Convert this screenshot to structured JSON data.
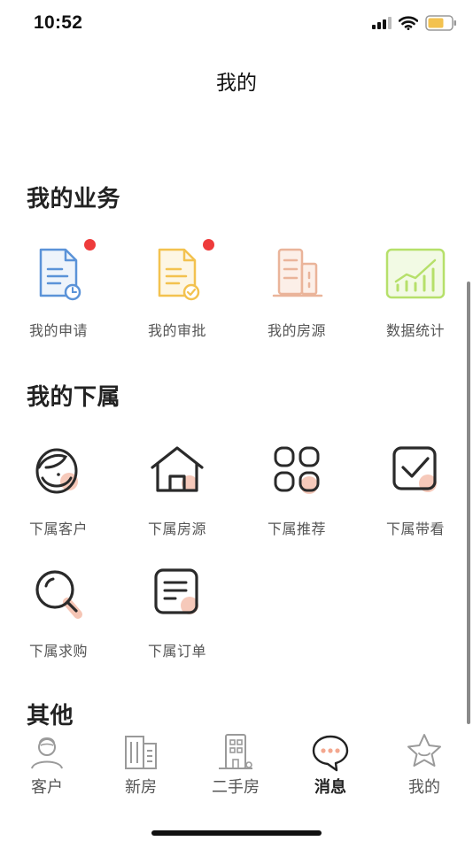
{
  "status_bar": {
    "time": "10:52",
    "icons": [
      "signal-icon",
      "wifi-icon",
      "battery-icon"
    ]
  },
  "nav": {
    "title": "我的"
  },
  "sections": {
    "business": {
      "title": "我的业务",
      "items": [
        {
          "label": "我的申请",
          "icon": "document-clock-icon",
          "badge": true
        },
        {
          "label": "我的审批",
          "icon": "document-check-icon",
          "badge": true
        },
        {
          "label": "我的房源",
          "icon": "building-icon",
          "badge": false
        },
        {
          "label": "数据统计",
          "icon": "bar-chart-icon",
          "badge": false
        }
      ]
    },
    "subordinates": {
      "title": "我的下属",
      "items": [
        {
          "label": "下属客户",
          "icon": "customer-face-icon"
        },
        {
          "label": "下属房源",
          "icon": "house-icon"
        },
        {
          "label": "下属推荐",
          "icon": "grid-apps-icon"
        },
        {
          "label": "下属带看",
          "icon": "checkbox-icon"
        },
        {
          "label": "下属求购",
          "icon": "magnifier-icon"
        },
        {
          "label": "下属订单",
          "icon": "order-list-icon"
        }
      ]
    },
    "other": {
      "title": "其他"
    }
  },
  "tab_bar": {
    "tabs": [
      {
        "label": "客户",
        "icon": "customer-tab-icon",
        "active": false
      },
      {
        "label": "新房",
        "icon": "new-house-tab-icon",
        "active": false
      },
      {
        "label": "二手房",
        "icon": "second-hand-house-tab-icon",
        "active": false
      },
      {
        "label": "消息",
        "icon": "message-tab-icon",
        "active": true
      },
      {
        "label": "我的",
        "icon": "profile-star-tab-icon",
        "active": false
      }
    ]
  },
  "colors": {
    "accent_blue": "#5b93d8",
    "accent_yellow": "#f3c24f",
    "accent_peach": "#eab49a",
    "accent_green": "#b6e06a",
    "badge_red": "#ee3b3b",
    "icon_dark": "#2a2a2a",
    "icon_shadow": "#f3b7a3",
    "tab_gray": "#9a9a9a"
  }
}
